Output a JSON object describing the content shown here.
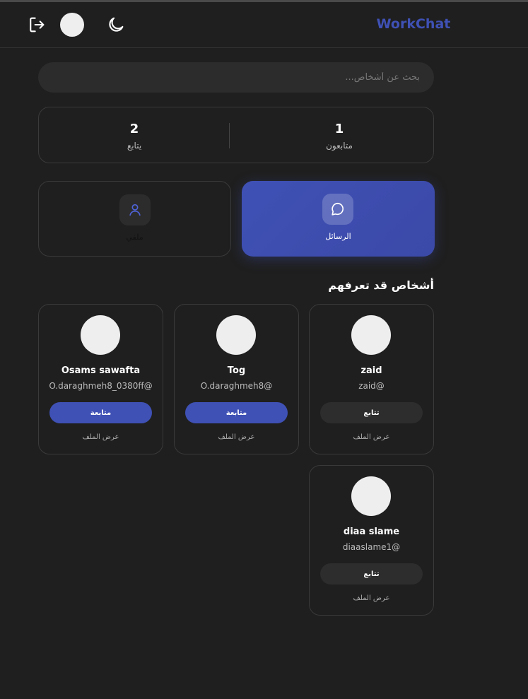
{
  "header": {
    "logo": "WorkChat",
    "icons": {
      "logout": "logout-icon",
      "theme": "moon-icon"
    }
  },
  "search": {
    "placeholder": "بحث عن أشخاص..."
  },
  "stats": {
    "following": {
      "value": "2",
      "label": "يتابع"
    },
    "followers": {
      "value": "1",
      "label": "متابعون"
    }
  },
  "nav": {
    "profile": {
      "label": "ملفي",
      "icon": "user-icon"
    },
    "messages": {
      "label": "الرسائل",
      "icon": "chat-bubble-icon"
    }
  },
  "suggestions": {
    "title": "أشخاص قد تعرفهم",
    "people": [
      {
        "name": "zaid",
        "handle": "zaid@",
        "button": "تتابع",
        "view": "عرض الملف"
      },
      {
        "name": "Tog",
        "handle": "O.daraghmeh8@",
        "button": "متابعة",
        "view": "عرض الملف"
      },
      {
        "name": "Osams sawafta",
        "handle": "O.daraghmeh8_0380ff@",
        "button": "متابعة",
        "view": "عرض الملف"
      },
      {
        "name": "diaa slame",
        "handle": "diaaslame1@",
        "button": "تتابع",
        "view": "عرض الملف"
      }
    ]
  },
  "colors": {
    "accent": "#3f51b5",
    "background": "#1f1f1f",
    "card_border": "#3a3a3a"
  }
}
